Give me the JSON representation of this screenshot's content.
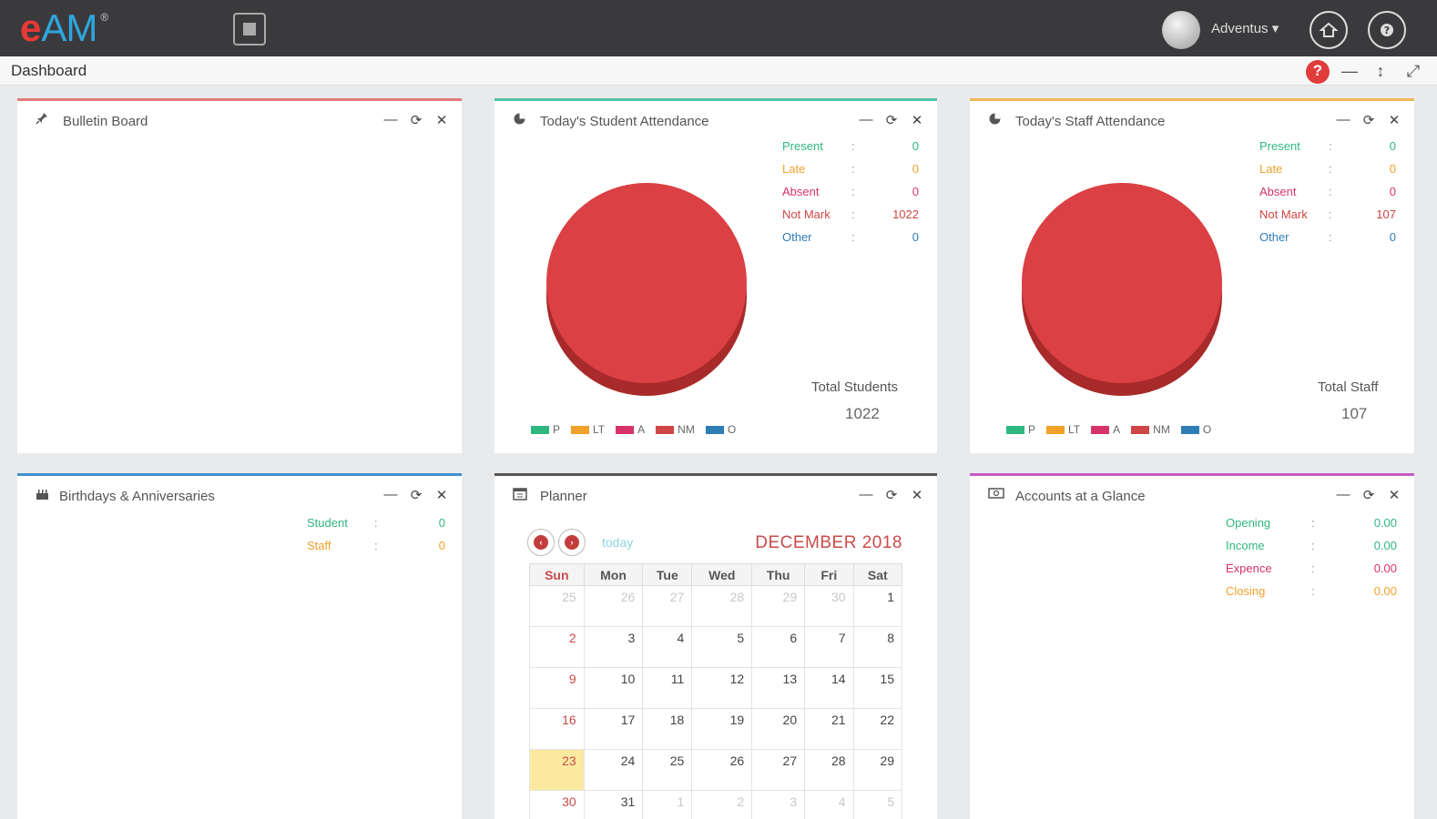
{
  "app": {
    "logo_e": "e",
    "logo_am": "AM",
    "logo_mark": "®",
    "user_name": "Adventus ▾",
    "icons": {
      "menu": "menu-toggle-icon",
      "home": "home-icon",
      "help": "help-icon"
    }
  },
  "page": {
    "title": "Dashboard",
    "help_glyph": "?",
    "minimize_glyph": "—",
    "vertical_glyph": "↕",
    "fullscreen_glyph": "⤢"
  },
  "panel_tools": {
    "minimize": "—",
    "refresh": "⟳",
    "close": "✕"
  },
  "bulletin": {
    "title": "Bulletin Board",
    "icon": "pin-icon"
  },
  "student_attendance": {
    "title": "Today's Student Attendance",
    "icon": "pie-chart-icon",
    "stats": [
      {
        "label": "Present",
        "value": "0",
        "color": "#2fb77f"
      },
      {
        "label": "Late",
        "value": "0",
        "color": "#f0a12c"
      },
      {
        "label": "Absent",
        "value": "0",
        "color": "#d6336c"
      },
      {
        "label": "Not Mark",
        "value": "1022",
        "color": "#d04545"
      },
      {
        "label": "Other",
        "value": "0",
        "color": "#2f7db5"
      }
    ],
    "total_label": "Total Students",
    "total_value": "1022"
  },
  "staff_attendance": {
    "title": "Today's Staff Attendance",
    "icon": "pie-chart-icon",
    "stats": [
      {
        "label": "Present",
        "value": "0",
        "color": "#2fb77f"
      },
      {
        "label": "Late",
        "value": "0",
        "color": "#f0a12c"
      },
      {
        "label": "Absent",
        "value": "0",
        "color": "#d6336c"
      },
      {
        "label": "Not Mark",
        "value": "107",
        "color": "#d04545"
      },
      {
        "label": "Other",
        "value": "0",
        "color": "#2f7db5"
      }
    ],
    "total_label": "Total Staff",
    "total_value": "107"
  },
  "legend": [
    {
      "label": "P",
      "color": "#2fb77f"
    },
    {
      "label": "LT",
      "color": "#f0a12c"
    },
    {
      "label": "A",
      "color": "#d6336c"
    },
    {
      "label": "NM",
      "color": "#d04545"
    },
    {
      "label": "O",
      "color": "#2f7db5"
    }
  ],
  "birthdays": {
    "title": "Birthdays & Anniversaries",
    "icon": "cake-icon",
    "stats": [
      {
        "label": "Student",
        "value": "0",
        "color": "#2fb77f"
      },
      {
        "label": "Staff",
        "value": "0",
        "color": "#f0a12c"
      }
    ]
  },
  "planner": {
    "title": "Planner",
    "icon": "calendar-icon",
    "prev_glyph": "‹",
    "next_glyph": "›",
    "today_label": "today",
    "month_title": "DECEMBER 2018",
    "weekdays": [
      "Sun",
      "Mon",
      "Tue",
      "Wed",
      "Thu",
      "Fri",
      "Sat"
    ],
    "weeks": [
      [
        "25",
        "26",
        "27",
        "28",
        "29",
        "30",
        "1"
      ],
      [
        "2",
        "3",
        "4",
        "5",
        "6",
        "7",
        "8"
      ],
      [
        "9",
        "10",
        "11",
        "12",
        "13",
        "14",
        "15"
      ],
      [
        "16",
        "17",
        "18",
        "19",
        "20",
        "21",
        "22"
      ],
      [
        "23",
        "24",
        "25",
        "26",
        "27",
        "28",
        "29"
      ],
      [
        "30",
        "31",
        "1",
        "2",
        "3",
        "4",
        "5"
      ]
    ],
    "today_cell": "23"
  },
  "accounts": {
    "title": "Accounts at a Glance",
    "icon": "money-icon",
    "stats": [
      {
        "label": "Opening",
        "value": "0.00",
        "color": "#2fb77f"
      },
      {
        "label": "Income",
        "value": "0.00",
        "color": "#2fb77f"
      },
      {
        "label": "Expence",
        "value": "0.00",
        "color": "#d6336c"
      },
      {
        "label": "Closing",
        "value": "0.00",
        "color": "#f0b65a"
      }
    ]
  },
  "colon": ":"
}
